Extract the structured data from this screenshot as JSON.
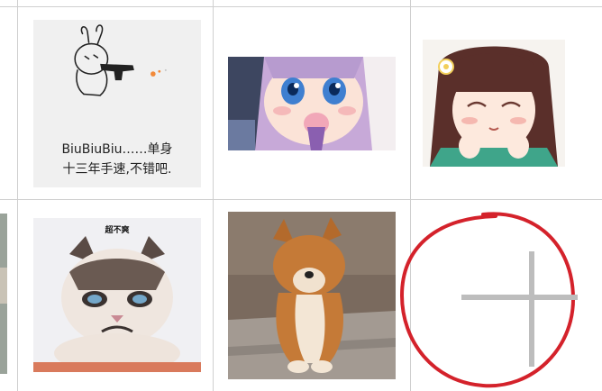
{
  "stickers": [
    {
      "name": "bunny-gun",
      "caption_line1": "BiuBiuBiu……单身",
      "caption_line2": "十三年手速,不错吧."
    },
    {
      "name": "anime-girl-eating",
      "caption": ""
    },
    {
      "name": "anime-girl-smiling",
      "caption": ""
    },
    {
      "name": "grumpy-cat",
      "caption": "超不爽"
    },
    {
      "name": "shiba-puppy",
      "caption": ""
    }
  ],
  "add_tile": {
    "icon": "plus-icon",
    "annotation": "red hand-drawn circle",
    "accent": "#d4222b"
  },
  "colors": {
    "grid": "#cfcfcf",
    "plus": "#bdbdbd",
    "circle": "#d4222b"
  }
}
